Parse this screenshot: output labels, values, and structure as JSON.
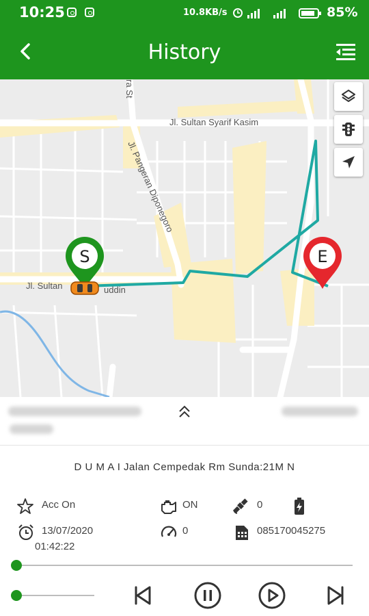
{
  "status_bar": {
    "time": "10:25",
    "speed": "10.8KB/s",
    "battery": "85%"
  },
  "app_bar": {
    "title": "History"
  },
  "map": {
    "streets": {
      "sultan_syarif_kasim": "Jl. Sultan Syarif Kasim",
      "pangeran_diponegoro": "Jl. Pangeran Diponegoro",
      "sultan_hasanuddin": "Jl. Sultan",
      "sultan_hasanuddin_tail": "uddin",
      "top_fragment": "ra St"
    },
    "start_marker": "S",
    "end_marker": "E",
    "route_color": "#1fa9a3"
  },
  "details": {
    "address": "D U M A I Jalan Cempedak Rm Sunda:21M N",
    "acc_label": "Acc On",
    "engine": "ON",
    "satellites": "0",
    "date": "13/07/2020",
    "time": "01:42:22",
    "speed": "0",
    "phone": "085170045275"
  },
  "colors": {
    "brand": "#1e951e",
    "start_pin": "#1e951e",
    "end_pin": "#e5272d"
  }
}
